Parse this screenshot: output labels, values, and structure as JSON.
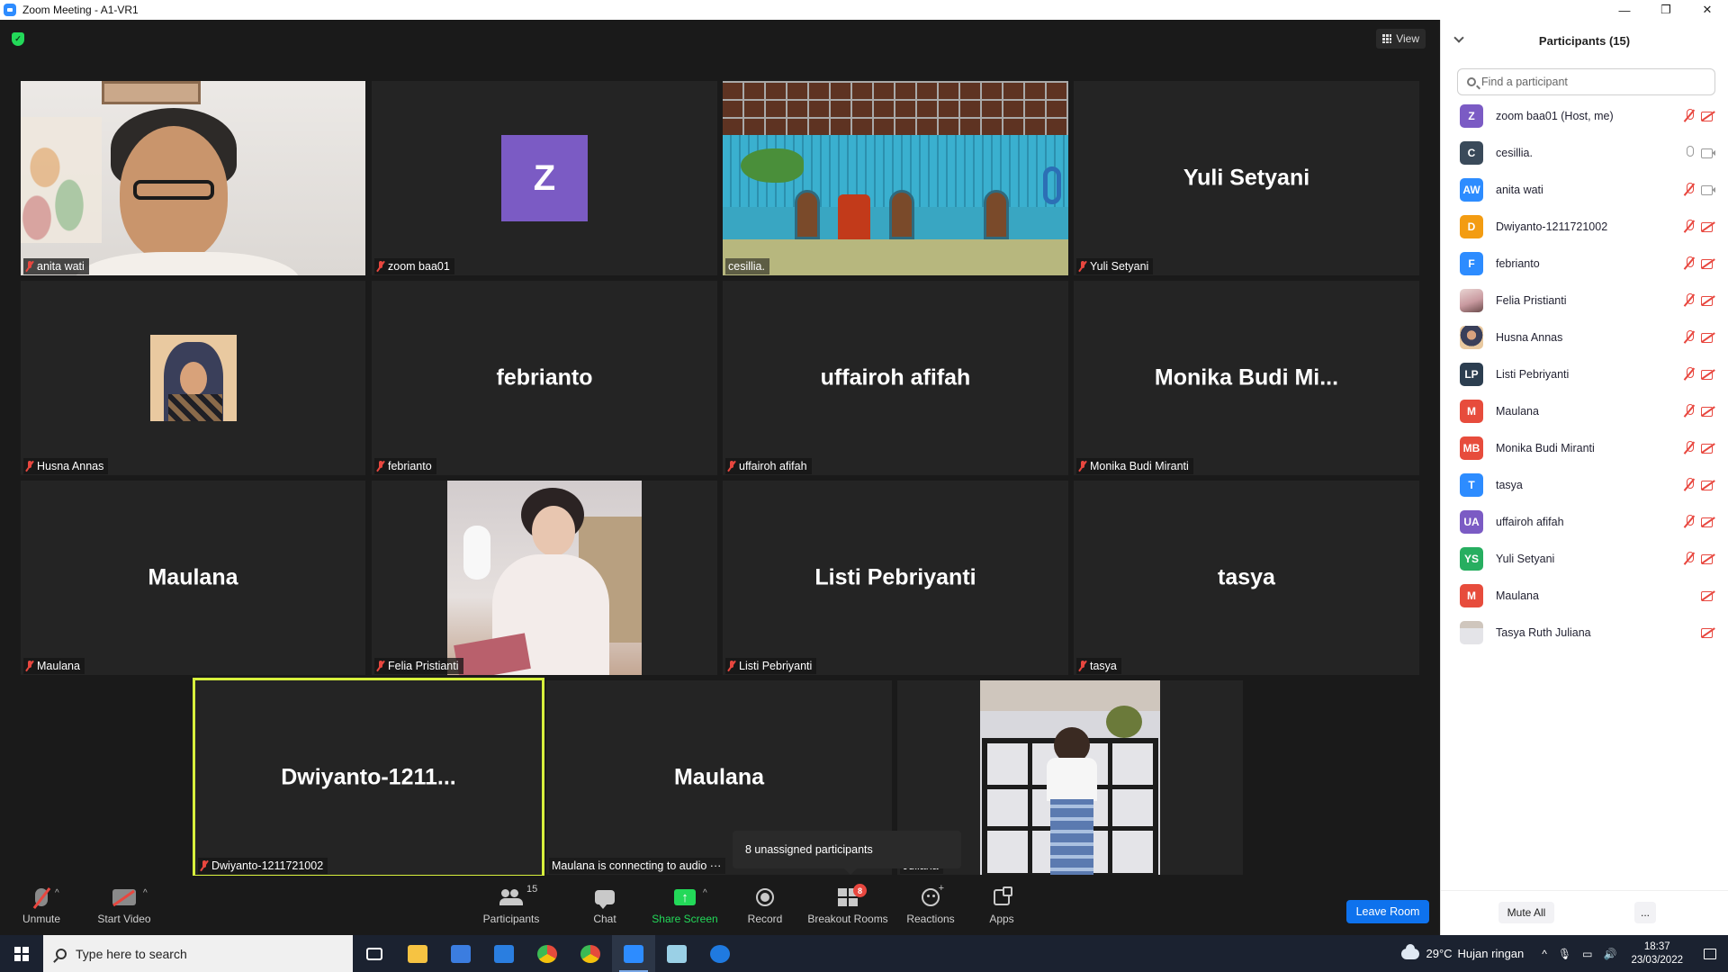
{
  "window": {
    "title": "Zoom Meeting - A1-VR1",
    "minimize": "—",
    "maximize": "❐",
    "close": "✕"
  },
  "meeting": {
    "view_label": "View",
    "tiles": [
      {
        "label": "anita wati",
        "big": ""
      },
      {
        "label": "zoom baa01",
        "big": "",
        "avatar_letter": "Z",
        "avatar_color": "#7B5BC4"
      },
      {
        "label": "cesillia.",
        "big": ""
      },
      {
        "label": "Yuli Setyani",
        "big": "Yuli Setyani"
      },
      {
        "label": "Husna Annas",
        "big": ""
      },
      {
        "label": "febrianto",
        "big": "febrianto"
      },
      {
        "label": "uffairoh afifah",
        "big": "uffairoh afifah"
      },
      {
        "label": "Monika Budi Miranti",
        "big": "Monika Budi Mi..."
      },
      {
        "label": "Maulana",
        "big": "Maulana"
      },
      {
        "label": "Felia Pristianti",
        "big": ""
      },
      {
        "label": "Listi Pebriyanti",
        "big": "Listi Pebriyanti"
      },
      {
        "label": "tasya",
        "big": "tasya"
      },
      {
        "label": "Dwiyanto-1211721002",
        "big": "Dwiyanto-1211..."
      },
      {
        "label": "Maulana is connecting to audio ···",
        "big": "Maulana"
      },
      {
        "label": "Juliana",
        "big": ""
      }
    ],
    "tooltip": "8 unassigned participants"
  },
  "toolbar": {
    "unmute": "Unmute",
    "start_video": "Start Video",
    "participants": "Participants",
    "participants_count": "15",
    "chat": "Chat",
    "share_screen": "Share Screen",
    "record": "Record",
    "breakout_rooms": "Breakout Rooms",
    "breakout_badge": "8",
    "reactions": "Reactions",
    "apps": "Apps",
    "leave": "Leave Room",
    "caret": "^"
  },
  "panel": {
    "title": "Participants (15)",
    "search_placeholder": "Find a participant",
    "participants": [
      {
        "initials": "Z",
        "color": "#7B5BC4",
        "name": "zoom baa01 (Host, me)",
        "mic": "off",
        "cam": "off"
      },
      {
        "initials": "C",
        "color": "#3a4a5a",
        "name": "cesillia.",
        "mic": "on",
        "cam": "on"
      },
      {
        "initials": "AW",
        "color": "#2D8CFF",
        "name": "anita wati",
        "mic": "off",
        "cam": "on"
      },
      {
        "initials": "D",
        "color": "#F39C12",
        "name": "Dwiyanto-1211721002",
        "mic": "off",
        "cam": "off"
      },
      {
        "initials": "F",
        "color": "#2D8CFF",
        "name": "febrianto",
        "mic": "off",
        "cam": "off"
      },
      {
        "initials": "",
        "color": "img1",
        "name": "Felia Pristianti",
        "mic": "off",
        "cam": "off"
      },
      {
        "initials": "",
        "color": "img2",
        "name": "Husna Annas",
        "mic": "off",
        "cam": "off"
      },
      {
        "initials": "LP",
        "color": "#2c3e50",
        "name": "Listi Pebriyanti",
        "mic": "off",
        "cam": "off"
      },
      {
        "initials": "M",
        "color": "#E74C3C",
        "name": "Maulana",
        "mic": "off",
        "cam": "off"
      },
      {
        "initials": "MB",
        "color": "#E74C3C",
        "name": "Monika Budi Miranti",
        "mic": "off",
        "cam": "off"
      },
      {
        "initials": "T",
        "color": "#2D8CFF",
        "name": "tasya",
        "mic": "off",
        "cam": "off"
      },
      {
        "initials": "UA",
        "color": "#7B5BC4",
        "name": "uffairoh afifah",
        "mic": "off",
        "cam": "off"
      },
      {
        "initials": "YS",
        "color": "#27AE60",
        "name": "Yuli Setyani",
        "mic": "off",
        "cam": "off"
      },
      {
        "initials": "M",
        "color": "#E74C3C",
        "name": "Maulana",
        "mic": "none",
        "cam": "off"
      },
      {
        "initials": "",
        "color": "img3",
        "name": "Tasya Ruth Juliana",
        "mic": "none",
        "cam": "off"
      }
    ],
    "mute_all": "Mute All",
    "more": "..."
  },
  "taskbar": {
    "search_placeholder": "Type here to search",
    "weather_temp": "29°C",
    "weather_text": "Hujan ringan",
    "time": "18:37",
    "date": "23/03/2022",
    "apps": [
      {
        "name": "task-view-icon",
        "color": "#ffffff"
      },
      {
        "name": "file-explorer-icon",
        "color": "#F6C342"
      },
      {
        "name": "microsoft-store-icon",
        "color": "#3b7de0"
      },
      {
        "name": "mail-icon",
        "color": "#2a7ee0"
      },
      {
        "name": "chrome-icon",
        "color": "#e54b3c"
      },
      {
        "name": "chrome-profile-icon",
        "color": "#e54b3c"
      },
      {
        "name": "zoom-icon",
        "color": "#2D8CFF"
      },
      {
        "name": "notepad-icon",
        "color": "#9ad0e6"
      },
      {
        "name": "teamviewer-icon",
        "color": "#1f7ae0"
      }
    ]
  }
}
